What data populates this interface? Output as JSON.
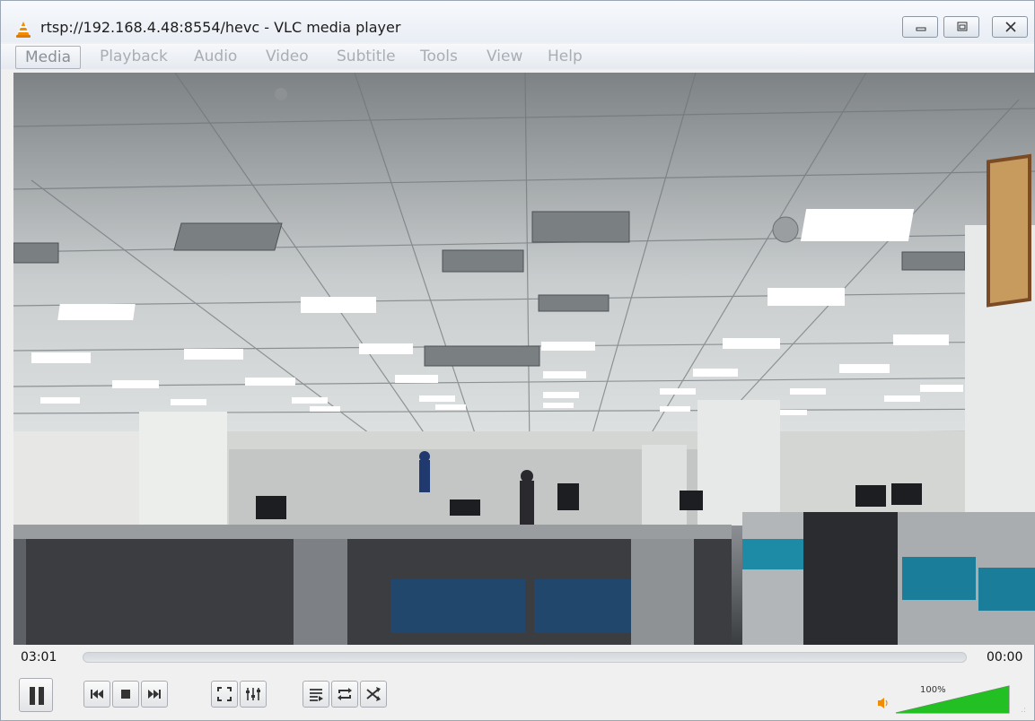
{
  "window": {
    "title": "rtsp://192.168.4.48:8554/hevc - VLC media player"
  },
  "menu": {
    "items": [
      "Media",
      "Playback",
      "Audio",
      "Video",
      "Subtitle",
      "Tools",
      "View",
      "Help"
    ]
  },
  "playback": {
    "elapsed": "03:01",
    "remaining": "00:00",
    "progress_fraction": 0.0
  },
  "volume": {
    "label": "100%",
    "level_fraction": 1.0
  },
  "icons": {
    "app": "vlc-cone-icon",
    "minimize": "minimize-icon",
    "maximize": "maximize-icon",
    "close": "close-icon",
    "pause": "pause-icon",
    "previous": "previous-icon",
    "stop": "stop-icon",
    "next": "next-icon",
    "fullscreen": "fullscreen-icon",
    "extended_settings": "equalizer-icon",
    "playlist": "playlist-icon",
    "loop": "loop-icon",
    "shuffle": "shuffle-icon",
    "speaker": "speaker-icon"
  },
  "colors": {
    "accent_orange": "#f28c00",
    "volume_green": "#22c022"
  }
}
